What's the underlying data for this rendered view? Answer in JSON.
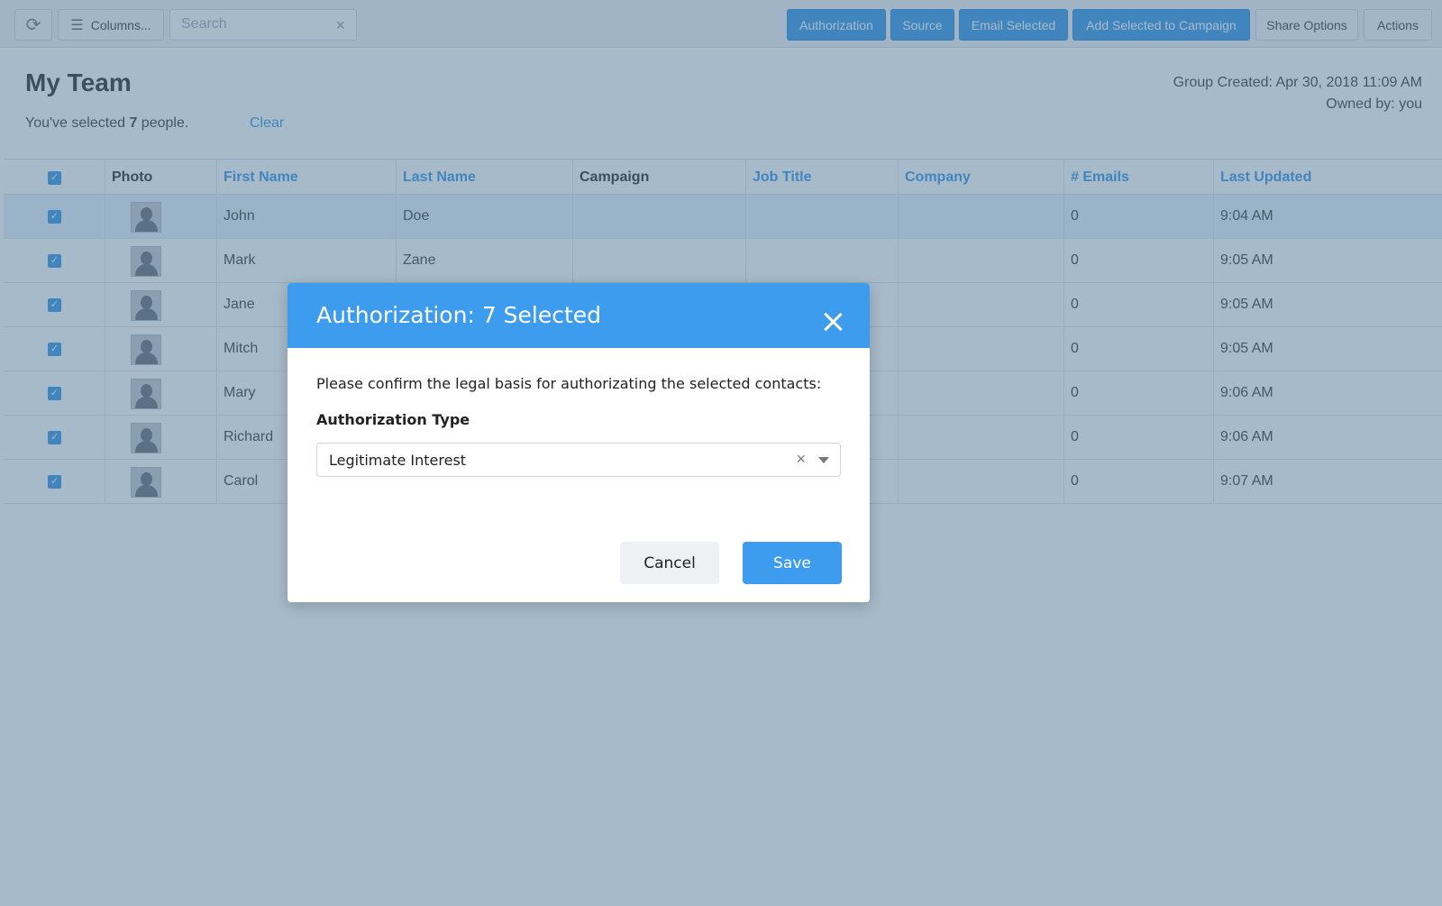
{
  "toolbar": {
    "refresh_icon": "refresh-icon",
    "columns_label": "Columns...",
    "search_placeholder": "Search",
    "buttons": [
      {
        "label": "Authorization"
      },
      {
        "label": "Source"
      },
      {
        "label": "Email Selected"
      },
      {
        "label": "Add Selected to Campaign"
      },
      {
        "label": "Share Options"
      },
      {
        "label": "Actions"
      }
    ]
  },
  "header": {
    "title": "My Team",
    "selected_prefix": "You've selected ",
    "selected_count": "7",
    "selected_suffix": " people.",
    "clear_label": "Clear",
    "group_created": "Group Created: Apr 30, 2018 11:09 AM",
    "owned_by": "Owned by: you"
  },
  "table": {
    "columns": [
      "Photo",
      "First Name",
      "Last Name",
      "Campaign",
      "Job Title",
      "Company",
      "# Emails",
      "Last Updated"
    ],
    "rows": [
      {
        "first": "John",
        "last": "Doe",
        "campaign": "",
        "job": "",
        "company": "",
        "emails": "0",
        "updated": "9:04 AM"
      },
      {
        "first": "Mark",
        "last": "Zane",
        "campaign": "",
        "job": "",
        "company": "",
        "emails": "0",
        "updated": "9:05 AM"
      },
      {
        "first": "Jane",
        "last": "",
        "campaign": "",
        "job": "",
        "company": "",
        "emails": "0",
        "updated": "9:05 AM"
      },
      {
        "first": "Mitch",
        "last": "",
        "campaign": "",
        "job": "",
        "company": "",
        "emails": "0",
        "updated": "9:05 AM"
      },
      {
        "first": "Mary",
        "last": "",
        "campaign": "",
        "job": "",
        "company": "",
        "emails": "0",
        "updated": "9:06 AM"
      },
      {
        "first": "Richard",
        "last": "",
        "campaign": "",
        "job": "",
        "company": "",
        "emails": "0",
        "updated": "9:06 AM"
      },
      {
        "first": "Carol",
        "last": "",
        "campaign": "",
        "job": "",
        "company": "",
        "emails": "0",
        "updated": "9:07 AM"
      }
    ]
  },
  "modal": {
    "title": "Authorization: 7 Selected",
    "description": "Please confirm the legal basis for authorizating the selected contacts:",
    "field_label": "Authorization Type",
    "selected_value": "Legitimate Interest",
    "cancel_label": "Cancel",
    "save_label": "Save"
  },
  "colors": {
    "accent": "#3d9ced",
    "overlay": "#486e91"
  }
}
